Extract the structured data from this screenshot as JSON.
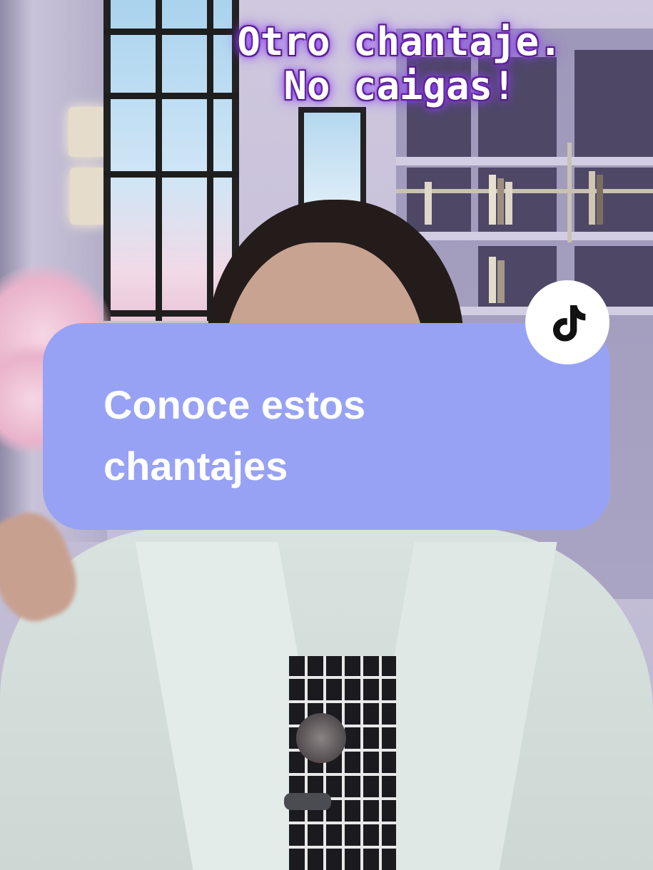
{
  "video": {
    "caption_lines": [
      "Otro chantaje.",
      "No caigas!"
    ]
  },
  "card": {
    "lines": [
      "Conoce estos",
      "chantajes"
    ],
    "background_color": "#97a2f5",
    "text_color": "#ffffff"
  },
  "badge": {
    "icon": "tiktok-logo-icon"
  },
  "colors": {
    "caption_glow": "#9b4dff"
  }
}
